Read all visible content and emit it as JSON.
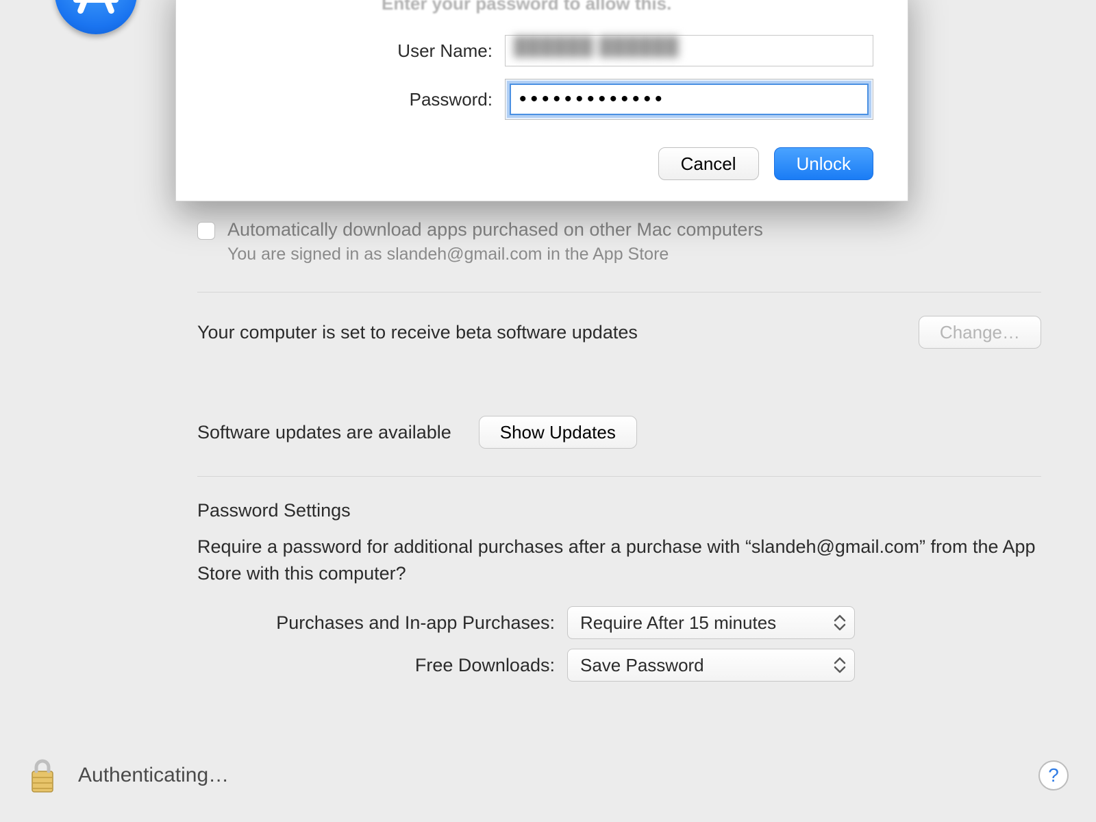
{
  "auth": {
    "prompt": "Enter your password to allow this.",
    "username_label": "User Name:",
    "username_value": "",
    "password_label": "Password:",
    "password_dots": "•••••••••••••",
    "cancel": "Cancel",
    "unlock": "Unlock"
  },
  "pane": {
    "auto_download_label": "Automatically download apps purchased on other Mac computers",
    "signed_in_text": "You are signed in as slandeh@gmail.com in the App Store",
    "beta_text": "Your computer is set to receive beta software updates",
    "change_btn": "Change…",
    "updates_text": "Software updates are available",
    "show_updates_btn": "Show Updates",
    "password_settings_title": "Password Settings",
    "password_settings_desc": "Require a password for additional purchases after a purchase with “slandeh@gmail.com” from the App Store with this computer?",
    "purchases_label": "Purchases and In-app Purchases:",
    "purchases_value": "Require After 15 minutes",
    "free_label": "Free Downloads:",
    "free_value": "Save Password"
  },
  "footer": {
    "status": "Authenticating…",
    "help": "?"
  }
}
